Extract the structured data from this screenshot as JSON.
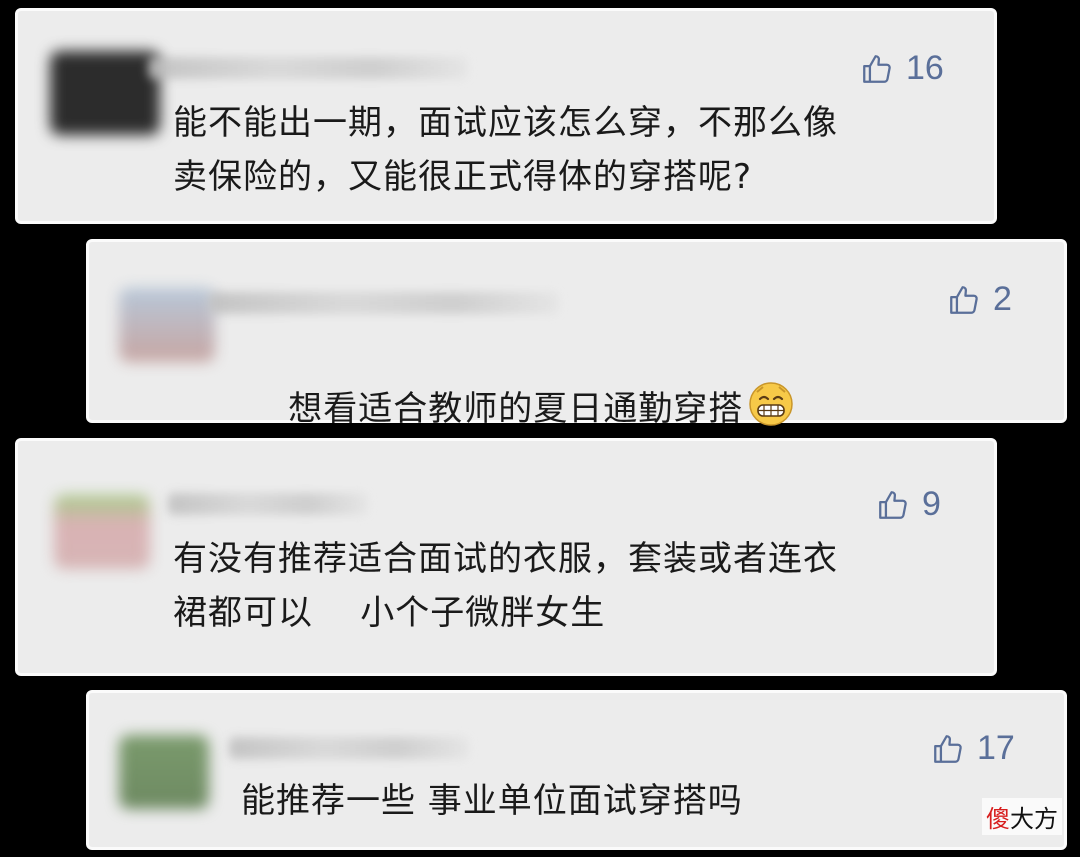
{
  "comments": [
    {
      "text_line1": "能不能出一期，面试应该怎么穿，不那么像",
      "text_line2": "卖保险的，又能很正式得体的穿搭呢?",
      "likes": "16"
    },
    {
      "text_line1": "想看适合教师的夏日通勤穿搭",
      "likes": "2"
    },
    {
      "text_line1": "有没有推荐适合面试的衣服，套装或者连衣",
      "text_line2": "裙都可以    小个子微胖女生",
      "likes": "9"
    },
    {
      "text_line1": "能推荐一些 事业单位面试穿搭吗",
      "likes": "17"
    }
  ],
  "watermark": {
    "first": "傻",
    "rest": "大方"
  }
}
